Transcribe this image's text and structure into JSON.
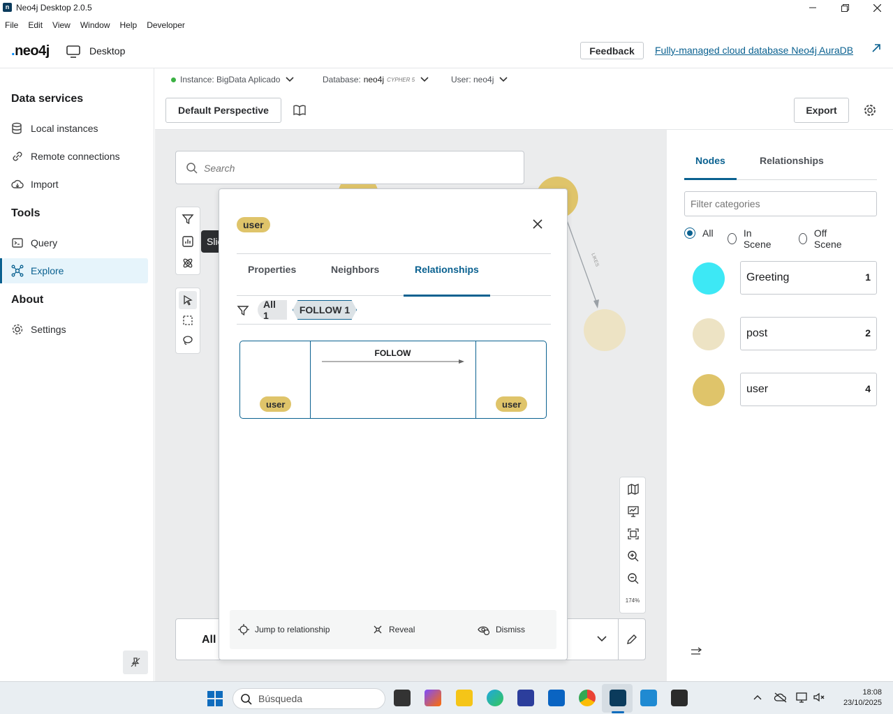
{
  "window": {
    "title": "Neo4j Desktop 2.0.5"
  },
  "menu": [
    "File",
    "Edit",
    "View",
    "Window",
    "Help",
    "Developer"
  ],
  "header": {
    "logo": "neo4j",
    "desktop_label": "Desktop",
    "feedback": "Feedback",
    "aura_link": "Fully-managed cloud database Neo4j AuraDB"
  },
  "sidebar": {
    "data_services": "Data services",
    "local_instances": "Local instances",
    "remote_connections": "Remote connections",
    "import": "Import",
    "tools": "Tools",
    "query": "Query",
    "explore": "Explore",
    "about": "About",
    "settings": "Settings"
  },
  "infobar": {
    "instance": "Instance: BigData Aplicado",
    "database_label": "Database:",
    "database_value": "neo4j",
    "cypher": "CYPHER 5",
    "user": "User: neo4j"
  },
  "toolbar": {
    "perspective": "Default Perspective",
    "export": "Export"
  },
  "canvas": {
    "search_placeholder": "Search",
    "tooltip": "Slicer",
    "edge_label": "LIKES",
    "bottom_text": "All",
    "zoom": "174%"
  },
  "inspector": {
    "node_label": "user",
    "tabs": [
      "Properties",
      "Neighbors",
      "Relationships"
    ],
    "chip_all": "All 1",
    "chip_follow": "FOLLOW 1",
    "rel_type": "FOLLOW",
    "from_label": "user",
    "to_label": "user",
    "actions": {
      "jump": "Jump to relationship",
      "reveal": "Reveal",
      "dismiss": "Dismiss"
    }
  },
  "right_panel": {
    "tab_nodes": "Nodes",
    "tab_relationships": "Relationships",
    "filter_placeholder": "Filter categories",
    "radios": [
      "All",
      "In Scene",
      "Off Scene"
    ],
    "categories": [
      {
        "name": "Greeting",
        "count": "1",
        "color": "#3de8f5"
      },
      {
        "name": "post",
        "count": "2",
        "color": "#ede3c4"
      },
      {
        "name": "user",
        "count": "4",
        "color": "#dfc46a"
      }
    ]
  },
  "taskbar": {
    "search": "Búsqueda",
    "time": "18:08",
    "date": "23/10/2025"
  }
}
